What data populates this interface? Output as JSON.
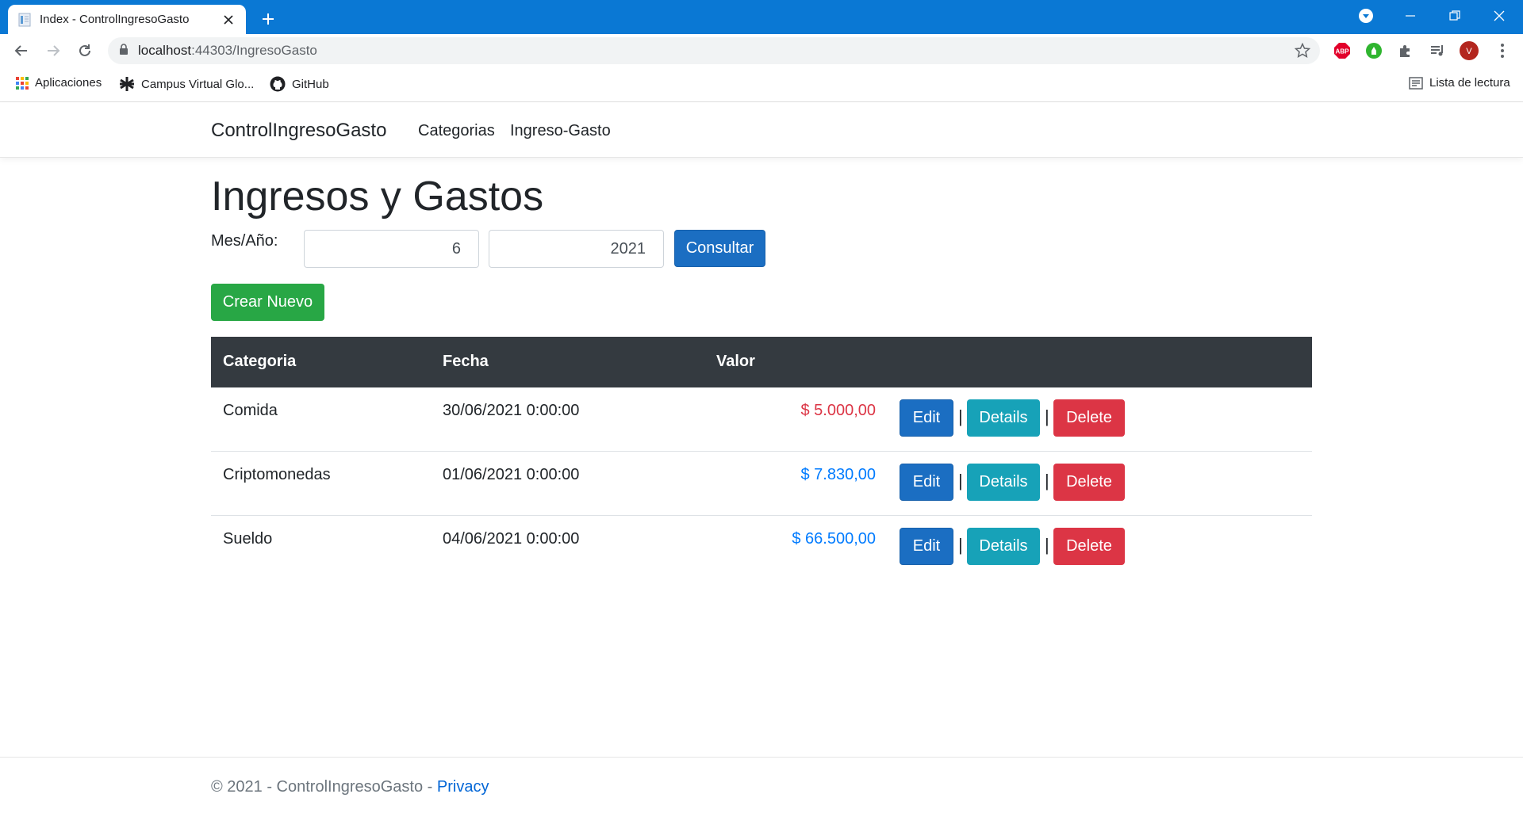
{
  "browser": {
    "tab_title": "Index - ControlIngresoGasto",
    "url_host": "localhost",
    "url_path": ":44303/IngresoGasto",
    "bookmarks": [
      "Aplicaciones",
      "Campus Virtual Glo...",
      "GitHub"
    ],
    "reading_list": "Lista de lectura",
    "profile_initial": "V",
    "extension_abp": "ABP"
  },
  "navbar": {
    "brand": "ControlIngresoGasto",
    "links": [
      "Categorias",
      "Ingreso-Gasto"
    ]
  },
  "main": {
    "title": "Ingresos y Gastos",
    "filter_label": "Mes/Año:",
    "month_value": "6",
    "year_value": "2021",
    "consult_button": "Consultar",
    "create_button": "Crear Nuevo"
  },
  "table": {
    "headers": [
      "Categoria",
      "Fecha",
      "Valor"
    ],
    "rows": [
      {
        "categoria": "Comida",
        "fecha": "30/06/2021 0:00:00",
        "valor": "$ 5.000,00",
        "valor_color": "#dc3545"
      },
      {
        "categoria": "Criptomonedas",
        "fecha": "01/06/2021 0:00:00",
        "valor": "$ 7.830,00",
        "valor_color": "#007bff"
      },
      {
        "categoria": "Sueldo",
        "fecha": "04/06/2021 0:00:00",
        "valor": "$ 66.500,00",
        "valor_color": "#007bff"
      }
    ],
    "actions": {
      "edit": "Edit",
      "details": "Details",
      "delete": "Delete",
      "separator": "|"
    }
  },
  "footer": {
    "text": "© 2021 - ControlIngresoGasto - ",
    "privacy_link": "Privacy"
  },
  "colors": {
    "chrome_titlebar": "#0a78d4",
    "primary": "#1b6ec2",
    "success": "#28a745",
    "info": "#17a2b8",
    "danger": "#dc3545",
    "table_header": "#343a40"
  }
}
